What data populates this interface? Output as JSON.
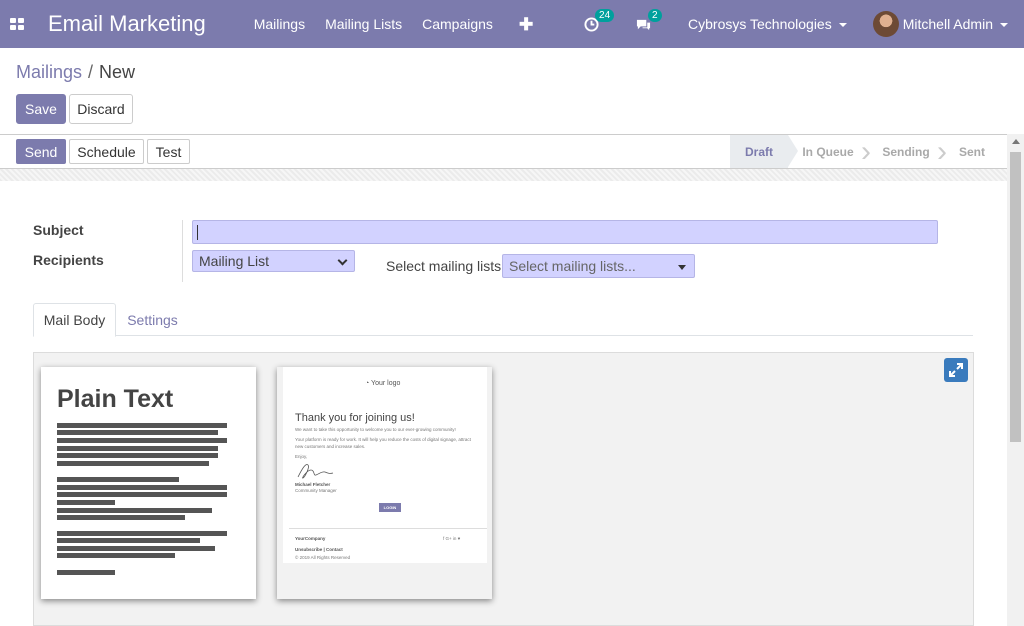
{
  "navbar": {
    "app_title": "Email Marketing",
    "menu": [
      "Mailings",
      "Mailing Lists",
      "Campaigns"
    ],
    "activity_count": "24",
    "message_count": "2",
    "company": "Cybrosys Technologies",
    "user": "Mitchell Admin"
  },
  "breadcrumb": {
    "parent": "Mailings",
    "current": "New"
  },
  "actions": {
    "save": "Save",
    "discard": "Discard"
  },
  "statusbar": {
    "send": "Send",
    "schedule": "Schedule",
    "test": "Test",
    "stages": [
      "Draft",
      "In Queue",
      "Sending",
      "Sent"
    ],
    "current_stage": "Draft"
  },
  "form": {
    "subject_label": "Subject",
    "subject_value": "",
    "recipients_label": "Recipients",
    "recipients_value": "Mailing List",
    "mailing_lists_label": "Select mailing lists:",
    "mailing_lists_placeholder": "Select mailing lists..."
  },
  "tabs": [
    "Mail Body",
    "Settings"
  ],
  "templates": {
    "plain_text_title": "Plain Text",
    "welcome": {
      "logo": "Your logo",
      "heading": "Thank you for joining us!",
      "line1": "We want to take this opportunity to welcome you to our ever-growing community!",
      "line2": "Your platform is ready for work. It will help you reduce the costs of digital signage, attract",
      "line3": "new customers and increase sales.",
      "enjoy": "Enjoy,",
      "signer": "Michael Fletcher",
      "role": "Community Manager",
      "login": "LOGIN",
      "company": "YourCompany",
      "unsubscribe": "Unsubscribe | Contact",
      "copyright": "© 2019 All Rights Reserved",
      "social": "f  G+  in  ♥"
    }
  },
  "colors": {
    "brand": "#7c7bad",
    "input_bg": "#d2d2ff",
    "badge": "#00a09d",
    "expand": "#3a7bbd"
  }
}
